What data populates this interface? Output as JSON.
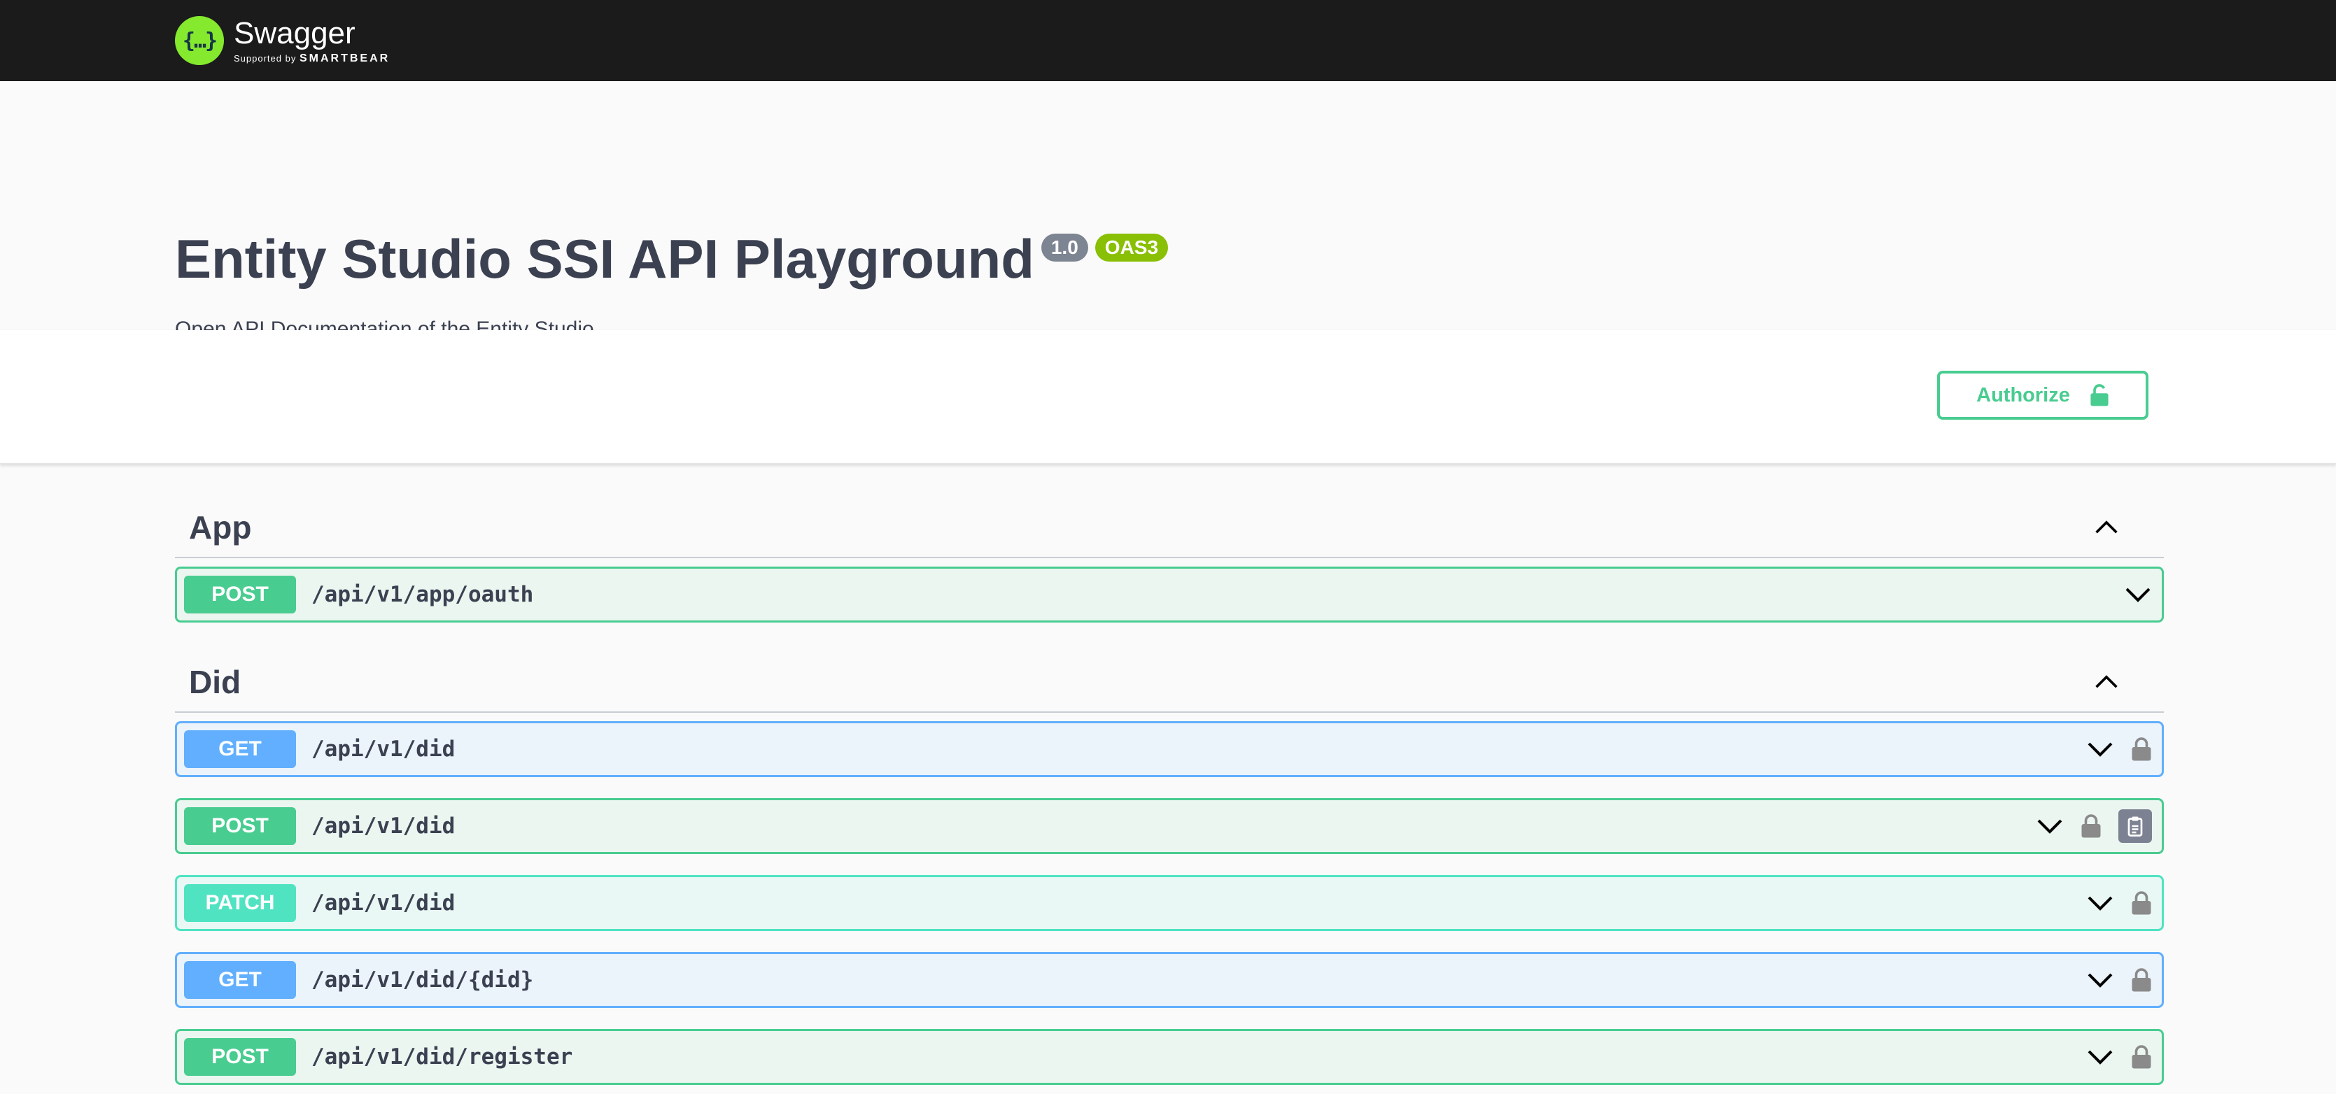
{
  "topbar": {
    "logo_glyph": "{…}",
    "logo_name": "Swagger",
    "logo_supported": "Supported by",
    "logo_company": "SMARTBEAR"
  },
  "info": {
    "title": "Entity Studio SSI API Playground",
    "version_badge": "1.0",
    "oas_badge": "OAS3",
    "description": "Open API Documentation of the Entity Studio"
  },
  "scheme": {
    "authorize_label": "Authorize"
  },
  "tags": [
    {
      "name": "App",
      "operations": [
        {
          "method": "POST",
          "path": "/api/v1/app/oauth"
        }
      ]
    },
    {
      "name": "Did",
      "operations": [
        {
          "method": "GET",
          "path": "/api/v1/did"
        },
        {
          "method": "POST",
          "path": "/api/v1/did"
        },
        {
          "method": "PATCH",
          "path": "/api/v1/did"
        },
        {
          "method": "GET",
          "path": "/api/v1/did/{did}"
        },
        {
          "method": "POST",
          "path": "/api/v1/did/register"
        }
      ]
    }
  ],
  "colors": {
    "post": "#49cc90",
    "get": "#61affe",
    "patch": "#50e3c2",
    "topbar": "#1b1b1b",
    "logo": "#85ea2d"
  },
  "icons": [
    "chevron-up-icon",
    "chevron-down-icon",
    "lock-icon",
    "copy-icon"
  ]
}
